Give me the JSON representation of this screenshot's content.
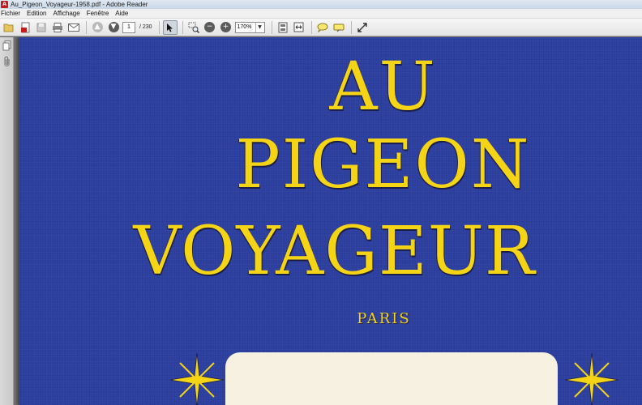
{
  "window": {
    "title": "Au_Pigeon_Voyageur-1958.pdf - Adobe Reader",
    "app_icon_glyph": "A"
  },
  "menu": [
    {
      "label": "Fichier"
    },
    {
      "label": "Edition"
    },
    {
      "label": "Affichage"
    },
    {
      "label": "Fenêtre"
    },
    {
      "label": "Aide"
    }
  ],
  "toolbar": {
    "current_page": "1",
    "page_total": " / 230",
    "zoom": "170%"
  },
  "document": {
    "line1": "AU",
    "line2": "PIGEON",
    "line3": "VOYAGEUR",
    "city": "PARIS"
  },
  "colors": {
    "cover_blue": "#2c3e9e",
    "title_yellow": "#f5d416",
    "banner_cream": "#f7f1e1"
  }
}
